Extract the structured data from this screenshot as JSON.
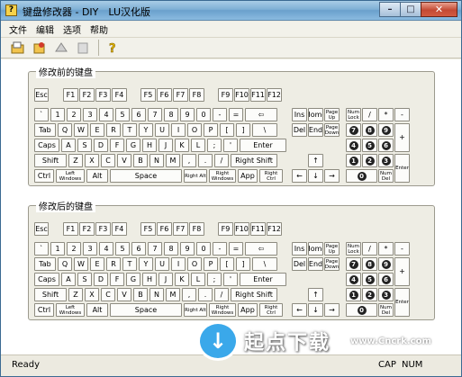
{
  "window": {
    "title": "键盘修改器 - DIY　LU汉化版",
    "minimize": "–",
    "maximize": "□",
    "close": "✕"
  },
  "menu": [
    "文件",
    "编辑",
    "选项",
    "帮助"
  ],
  "toolbar": [
    "open-icon",
    "save-icon",
    "apply-icon",
    "disabled-icon",
    "help-icon"
  ],
  "panels": {
    "before_label": "修改前的键盘",
    "after_label": "修改后的键盘"
  },
  "keyboard": {
    "function_row": [
      "Esc",
      "F1",
      "F2",
      "F3",
      "F4",
      "F5",
      "F6",
      "F7",
      "F8",
      "F9",
      "F10",
      "F11",
      "F12"
    ],
    "number_row": [
      "`",
      "1",
      "2",
      "3",
      "4",
      "5",
      "6",
      "7",
      "8",
      "9",
      "0",
      "-",
      "=",
      "⇦"
    ],
    "tab_row": [
      "Tab",
      "Q",
      "W",
      "E",
      "R",
      "T",
      "Y",
      "U",
      "I",
      "O",
      "P",
      "[",
      "]",
      "\\"
    ],
    "caps_row": [
      "Caps",
      "A",
      "S",
      "D",
      "F",
      "G",
      "H",
      "J",
      "K",
      "L",
      ";",
      "'",
      "Enter"
    ],
    "shift_row": [
      "Shift",
      "Z",
      "X",
      "C",
      "V",
      "B",
      "N",
      "M",
      ",",
      ".",
      "/",
      "Right Shift"
    ],
    "bottom_row": [
      "Ctrl",
      "Left Windows",
      "Alt",
      "Space",
      "Right Alt",
      "Right Windows",
      "App",
      "Right Ctrl"
    ],
    "nav_top": [
      "Ins",
      "Home",
      "Page Up"
    ],
    "nav_bottom": [
      "Del",
      "End",
      "Page Down"
    ],
    "arrows": [
      "↑",
      "←",
      "↓",
      "→"
    ],
    "numpad_row1": [
      "Num Lock",
      "/",
      "*",
      "-"
    ],
    "numpad_row2": [
      "7",
      "8",
      "9"
    ],
    "numpad_row3": [
      "4",
      "5",
      "6"
    ],
    "numpad_row4": [
      "1",
      "2",
      "3"
    ],
    "numpad_plus": "+",
    "numpad_zero": "0",
    "numpad_del": "Num Del",
    "numpad_enter": "Enter"
  },
  "status": {
    "left": "Ready",
    "cap": "CAP",
    "num": "NUM"
  },
  "watermark": {
    "text": "起点下载",
    "url": "www.Cncrk.com"
  }
}
